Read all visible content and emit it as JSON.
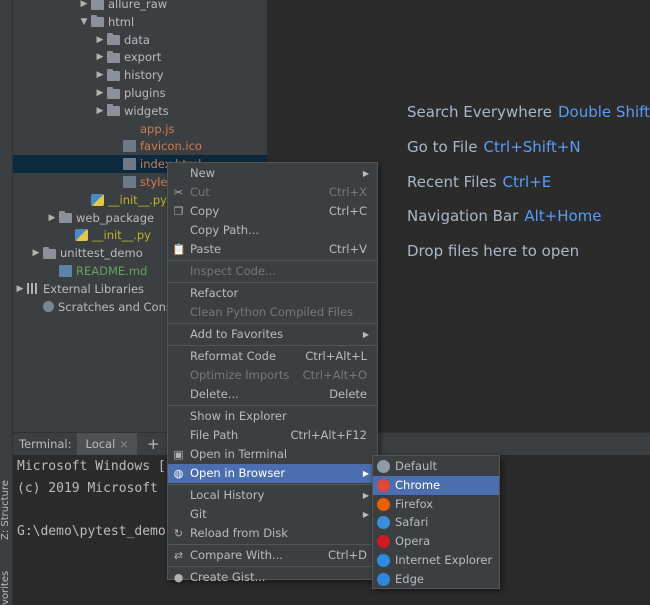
{
  "tool_window_tabs": {
    "structure": "Z: Structure",
    "favorites": "vorites"
  },
  "project_tree": [
    {
      "label": "allure_raw",
      "indent": 4,
      "arrow": "▶",
      "icon": "folder-icon",
      "color": "normal"
    },
    {
      "label": "html",
      "indent": 4,
      "arrow": "▼",
      "icon": "folder-icon",
      "color": "normal"
    },
    {
      "label": "data",
      "indent": 5,
      "arrow": "▶",
      "icon": "folder-icon",
      "color": "normal"
    },
    {
      "label": "export",
      "indent": 5,
      "arrow": "▶",
      "icon": "folder-icon",
      "color": "normal"
    },
    {
      "label": "history",
      "indent": 5,
      "arrow": "▶",
      "icon": "folder-icon",
      "color": "normal"
    },
    {
      "label": "plugins",
      "indent": 5,
      "arrow": "▶",
      "icon": "folder-icon",
      "color": "normal"
    },
    {
      "label": "widgets",
      "indent": 5,
      "arrow": "▶",
      "icon": "folder-icon",
      "color": "normal"
    },
    {
      "label": "app.js",
      "indent": 6,
      "arrow": "",
      "icon": "js-file-icon",
      "color": "orange"
    },
    {
      "label": "favicon.ico",
      "indent": 6,
      "arrow": "",
      "icon": "image-file-icon",
      "color": "orange"
    },
    {
      "label": "index.html",
      "indent": 6,
      "arrow": "",
      "icon": "html-file-icon",
      "color": "orange",
      "selected": true
    },
    {
      "label": "styles.css",
      "indent": 6,
      "arrow": "",
      "icon": "css-file-icon",
      "color": "orange"
    },
    {
      "label": "__init__.py",
      "indent": 4,
      "arrow": "",
      "icon": "python-file-icon",
      "color": "yellow"
    },
    {
      "label": "web_package",
      "indent": 2,
      "arrow": "▶",
      "icon": "folder-icon",
      "color": "normal"
    },
    {
      "label": "__init__.py",
      "indent": 3,
      "arrow": "",
      "icon": "python-file-icon",
      "color": "yellow"
    },
    {
      "label": "unittest_demo",
      "indent": 1,
      "arrow": "▶",
      "icon": "folder-icon",
      "color": "normal"
    },
    {
      "label": "README.md",
      "indent": 2,
      "arrow": "",
      "icon": "markdown-file-icon",
      "color": "green"
    },
    {
      "label": "External Libraries",
      "indent": 0,
      "arrow": "▶",
      "icon": "library-icon",
      "color": "normal"
    },
    {
      "label": "Scratches and Consoles",
      "indent": 1,
      "arrow": "",
      "icon": "scratch-icon",
      "color": "normal"
    }
  ],
  "editor_hints": [
    {
      "label": "Search Everywhere",
      "key": "Double Shift"
    },
    {
      "label": "Go to File",
      "key": "Ctrl+Shift+N"
    },
    {
      "label": "Recent Files",
      "key": "Ctrl+E"
    },
    {
      "label": "Navigation Bar",
      "key": "Alt+Home"
    },
    {
      "label": "Drop files here to open",
      "key": ""
    }
  ],
  "terminal": {
    "label": "Terminal:",
    "tab": "Local",
    "close": "×",
    "add": "+",
    "lines": [
      "Microsoft Windows [",
      "(c) 2019 Microsoft",
      "",
      "G:\\demo\\pytest_demo"
    ]
  },
  "context_menu": [
    {
      "label": "New",
      "shortcut": "",
      "submenu": true,
      "icon": ""
    },
    {
      "label": "Cut",
      "shortcut": "Ctrl+X",
      "disabled": true,
      "icon": "cut-icon",
      "glyph": "✂"
    },
    {
      "label": "Copy",
      "shortcut": "Ctrl+C",
      "icon": "copy-icon",
      "glyph": "❐"
    },
    {
      "label": "Copy Path...",
      "shortcut": "",
      "icon": ""
    },
    {
      "label": "Paste",
      "shortcut": "Ctrl+V",
      "icon": "paste-icon",
      "glyph": "📋"
    },
    {
      "sep": true
    },
    {
      "label": "Inspect Code...",
      "shortcut": "",
      "disabled": true,
      "icon": ""
    },
    {
      "sep": true
    },
    {
      "label": "Refactor",
      "shortcut": "",
      "icon": ""
    },
    {
      "label": "Clean Python Compiled Files",
      "shortcut": "",
      "disabled": true,
      "icon": ""
    },
    {
      "sep": true
    },
    {
      "label": "Add to Favorites",
      "shortcut": "",
      "submenu": true,
      "icon": ""
    },
    {
      "sep": true
    },
    {
      "label": "Reformat Code",
      "shortcut": "Ctrl+Alt+L",
      "icon": ""
    },
    {
      "label": "Optimize Imports",
      "shortcut": "Ctrl+Alt+O",
      "disabled": true,
      "icon": ""
    },
    {
      "label": "Delete...",
      "shortcut": "Delete",
      "icon": ""
    },
    {
      "sep": true
    },
    {
      "label": "Show in Explorer",
      "shortcut": "",
      "icon": ""
    },
    {
      "label": "File Path",
      "shortcut": "Ctrl+Alt+F12",
      "icon": ""
    },
    {
      "label": "Open in Terminal",
      "shortcut": "",
      "icon": "terminal-icon",
      "glyph": "▣"
    },
    {
      "label": "Open in Browser",
      "shortcut": "",
      "submenu": true,
      "highlight": true,
      "icon": "globe-icon",
      "glyph": "◍"
    },
    {
      "sep": true
    },
    {
      "label": "Local History",
      "shortcut": "",
      "submenu": true,
      "icon": ""
    },
    {
      "label": "Git",
      "shortcut": "",
      "submenu": true,
      "icon": ""
    },
    {
      "label": "Reload from Disk",
      "shortcut": "",
      "icon": "reload-icon",
      "glyph": "↻"
    },
    {
      "sep": true
    },
    {
      "label": "Compare With...",
      "shortcut": "Ctrl+D",
      "icon": "compare-icon",
      "glyph": "⇄"
    },
    {
      "sep": true
    },
    {
      "label": "Create Gist...",
      "shortcut": "",
      "icon": "github-icon",
      "glyph": "●"
    }
  ],
  "browser_submenu": [
    {
      "label": "Default",
      "icon": "default-browser-icon",
      "color": "#8e9aa6"
    },
    {
      "label": "Chrome",
      "icon": "chrome-icon",
      "color": "#e0483a",
      "highlight": true
    },
    {
      "label": "Firefox",
      "icon": "firefox-icon",
      "color": "#e66000"
    },
    {
      "label": "Safari",
      "icon": "safari-icon",
      "color": "#3b8de0"
    },
    {
      "label": "Opera",
      "icon": "opera-icon",
      "color": "#cc1b22"
    },
    {
      "label": "Internet Explorer",
      "icon": "internet-explorer-icon",
      "color": "#2a8de0"
    },
    {
      "label": "Edge",
      "icon": "edge-icon",
      "color": "#2e86de"
    }
  ],
  "colors": {
    "menu_highlight": "#4b6eaf",
    "accent_key": "#589df6"
  }
}
